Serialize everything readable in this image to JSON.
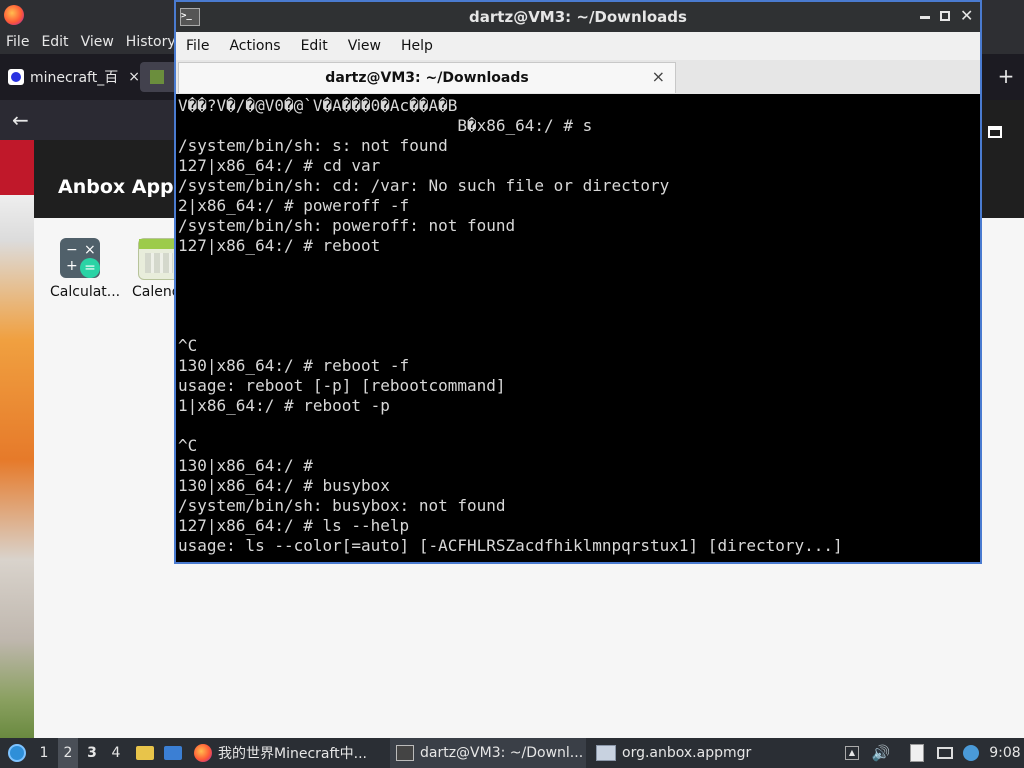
{
  "firefox": {
    "menu": [
      "File",
      "Edit",
      "View",
      "History"
    ],
    "tabs": [
      {
        "label": "minecraft_百",
        "close": "×"
      }
    ],
    "new_tab": "+"
  },
  "anbox": {
    "title": "Anbox Applic",
    "apps": [
      {
        "label": "Calculat...",
        "icon": "calculator-icon"
      },
      {
        "label": "Calend",
        "icon": "calendar-icon"
      }
    ]
  },
  "terminal": {
    "window_title": "dartz@VM3: ~/Downloads",
    "menu": [
      "File",
      "Actions",
      "Edit",
      "View",
      "Help"
    ],
    "tab_title": "dartz@VM3: ~/Downloads",
    "tab_close": "×",
    "lines": [
      "V��?V�/�@V0�@`V�A���0�Ac��A�B",
      "                             B�x86_64:/ # s",
      "/system/bin/sh: s: not found",
      "127|x86_64:/ # cd var",
      "/system/bin/sh: cd: /var: No such file or directory",
      "2|x86_64:/ # poweroff -f",
      "/system/bin/sh: poweroff: not found",
      "127|x86_64:/ # reboot",
      "",
      "",
      "",
      "",
      "^C",
      "130|x86_64:/ # reboot -f",
      "usage: reboot [-p] [rebootcommand]",
      "1|x86_64:/ # reboot -p",
      "",
      "^C",
      "130|x86_64:/ #",
      "130|x86_64:/ # busybox",
      "/system/bin/sh: busybox: not found",
      "127|x86_64:/ # ls --help",
      "usage: ls --color[=auto] [-ACFHLRSZacdfhiklmnpqrstux1] [directory...]"
    ]
  },
  "taskbar": {
    "workspaces": [
      "1",
      "2",
      "3",
      "4"
    ],
    "active_workspace": "2",
    "tasks": [
      {
        "label": "我的世界Minecraft中...",
        "icon": "firefox-icon"
      },
      {
        "label": "dartz@VM3: ~/Downl...",
        "icon": "terminal-icon"
      },
      {
        "label": "org.anbox.appmgr",
        "icon": "window-icon"
      }
    ],
    "clock": "9:08"
  },
  "colors": {
    "terminal_bg": "#000000",
    "terminal_fg": "#d8d8d8",
    "active_border": "#4a7bd0",
    "taskbar_bg": "#2a2e34"
  }
}
